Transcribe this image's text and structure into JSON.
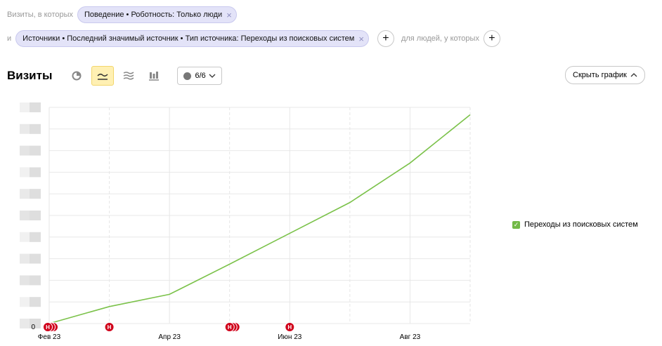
{
  "filters": {
    "row1_prefix": "Визиты, в которых",
    "chip1": "Поведение • Роботность: Только люди",
    "row2_prefix": "и",
    "chip2": "Источники • Последний значимый источник • Тип источника: Переходы из поисковых систем",
    "people_label": "для людей, у которых"
  },
  "toolbar": {
    "title": "Визиты",
    "counter": "6/6",
    "hide_chart": "Скрыть график"
  },
  "chart_data": {
    "type": "line",
    "x_ticks": [
      "Фев 23",
      "Апр 23",
      "Июн 23",
      "Авг 23"
    ],
    "y_ticks": [
      "0"
    ],
    "series": [
      {
        "name": "Переходы из поисковых систем",
        "color": "#7bc24a",
        "values": [
          0,
          0.081,
          0.139,
          0.283,
          0.43,
          0.577,
          0.765,
          0.995
        ]
      }
    ],
    "x": [
      "2023-02",
      "2023-03",
      "2023-04",
      "2023-05",
      "2023-06",
      "2023-07",
      "2023-08",
      "2023-09"
    ],
    "annotation_label": "Н",
    "annotations_at": [
      "2023-02",
      "2023-03",
      "2023-05",
      "2023-06"
    ],
    "legend_position": "right",
    "grid": true
  }
}
